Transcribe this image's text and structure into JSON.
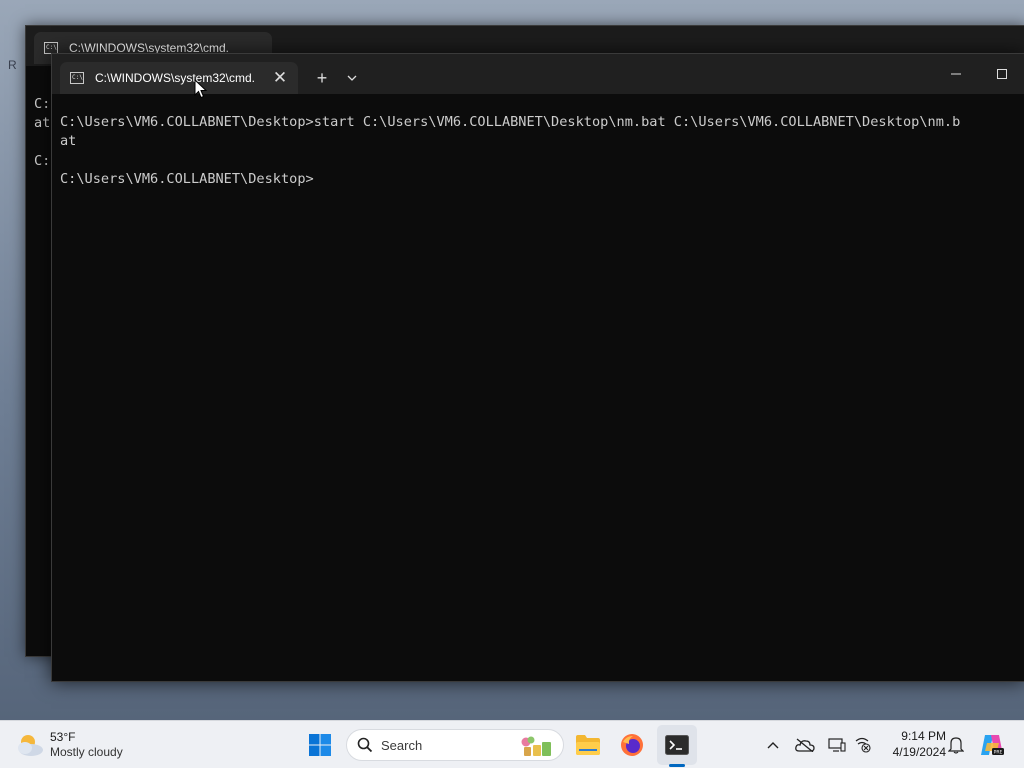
{
  "desktop": {
    "edge_text": "R"
  },
  "back_window": {
    "tab_title": "C:\\WINDOWS\\system32\\cmd.",
    "icon_text": "C:\\",
    "lines": [
      "C:",
      "at",
      "",
      "C:"
    ]
  },
  "front_window": {
    "tab_title": "C:\\WINDOWS\\system32\\cmd.",
    "icon_text": "C:\\",
    "new_tab": "+",
    "lines": [
      "",
      "C:\\Users\\VM6.COLLABNET\\Desktop>start C:\\Users\\VM6.COLLABNET\\Desktop\\nm.bat C:\\Users\\VM6.COLLABNET\\Desktop\\nm.b",
      "at",
      "",
      "C:\\Users\\VM6.COLLABNET\\Desktop>"
    ]
  },
  "taskbar": {
    "weather": {
      "temp": "53°F",
      "condition": "Mostly cloudy",
      "icon": "partly-cloudy-icon"
    },
    "search": {
      "placeholder": "Search"
    },
    "apps": [
      "start-icon",
      "widgets-icon",
      "file-explorer-icon",
      "firefox-icon",
      "terminal-icon"
    ],
    "tray_icons": [
      "chevron-up-icon",
      "onedrive-icon",
      "display-icon",
      "network-icon",
      "notification-bell-icon",
      "copilot-icon"
    ],
    "clock": {
      "time": "9:14 PM",
      "date": "4/19/2024"
    }
  },
  "colors": {
    "terminal_bg": "#0c0c0c",
    "terminal_text": "#cccccc",
    "tabstrip_bg": "#202020",
    "taskbar_bg": "#eef0f4",
    "accent": "#0067c0"
  }
}
